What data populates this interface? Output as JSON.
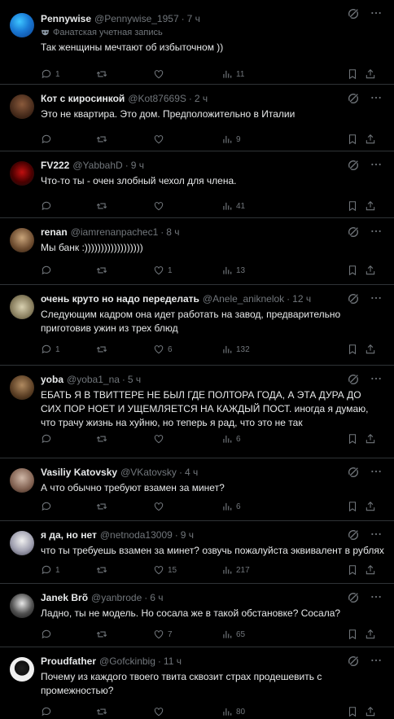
{
  "colors": {
    "background": "#000000",
    "text": "#e7e9ea",
    "muted": "#71767b",
    "border": "#2f3336"
  },
  "tweets": [
    {
      "name": "Pennywise",
      "handle": "@Pennywise_1957",
      "sep": "·",
      "time": "7 ч",
      "badge": "Фанатская учетная запись",
      "text": "Так женщины мечтают об избыточном ))",
      "replies": "1",
      "retweets": "",
      "likes": "",
      "views": "11"
    },
    {
      "name": "Кот с киросинкой",
      "handle": "@Kot87669S",
      "sep": "·",
      "time": "2 ч",
      "text": "Это не квартира. Это дом. Предположительно в Италии",
      "replies": "",
      "retweets": "",
      "likes": "",
      "views": "9"
    },
    {
      "name": "FV222",
      "handle": "@YabbahD",
      "sep": "·",
      "time": "9 ч",
      "text": "Что-то ты - очен злобный чехол для члена.",
      "replies": "",
      "retweets": "",
      "likes": "",
      "views": "41"
    },
    {
      "name": "renan",
      "handle": "@iamrenanpachec1",
      "sep": "·",
      "time": "8 ч",
      "text": "Мы банк :))))))))))))))))))",
      "replies": "",
      "retweets": "",
      "likes": "1",
      "views": "13"
    },
    {
      "name": "очень круто но надо переделать",
      "handle": "@Anele_aniknelok",
      "sep": "·",
      "time": "12 ч",
      "text": "Следующим кадром она идет работать на завод, предварительно приготовив ужин из трех блюд",
      "replies": "1",
      "retweets": "",
      "likes": "6",
      "views": "132"
    },
    {
      "name": "yoba",
      "handle": "@yoba1_na",
      "sep": "·",
      "time": "5 ч",
      "text": "ЕБАТЬ Я В ТВИТТЕРЕ НЕ БЫЛ ГДЕ ПОЛТОРА ГОДА, А ЭТА ДУРА ДО СИХ ПОР НОЕТ И УЩЕМЛЯЕТСЯ НА КАЖДЫЙ ПОСТ. иногда я думаю, что трачу жизнь на хуйню, но теперь я рад, что это не так",
      "replies": "",
      "retweets": "",
      "likes": "",
      "views": "6"
    },
    {
      "name": "Vasiliy Katovsky",
      "handle": "@VKatovsky",
      "sep": "·",
      "time": "4 ч",
      "text": "А что обычно требуют взамен за минет?",
      "replies": "",
      "retweets": "",
      "likes": "",
      "views": "6"
    },
    {
      "name": "я да, но нет",
      "handle": "@netnoda13009",
      "sep": "·",
      "time": "9 ч",
      "text": "что ты требуешь взамен за минет? озвучь пожалуйста эквивалент в рублях",
      "replies": "1",
      "retweets": "",
      "likes": "15",
      "views": "217"
    },
    {
      "name": "Janek Brõ",
      "handle": "@yanbrode",
      "sep": "·",
      "time": "6 ч",
      "text": "Ладно, ты не модель. Но сосала же в такой обстановке? Сосала?",
      "replies": "",
      "retweets": "",
      "likes": "7",
      "views": "65"
    },
    {
      "name": "Proudfather",
      "handle": "@Gofckinbig",
      "sep": "·",
      "time": "11 ч",
      "text": "Почему из каждого твоего твита сквозит страх продешевить с промежностью?",
      "replies": "",
      "retweets": "",
      "likes": "",
      "views": "80"
    }
  ]
}
